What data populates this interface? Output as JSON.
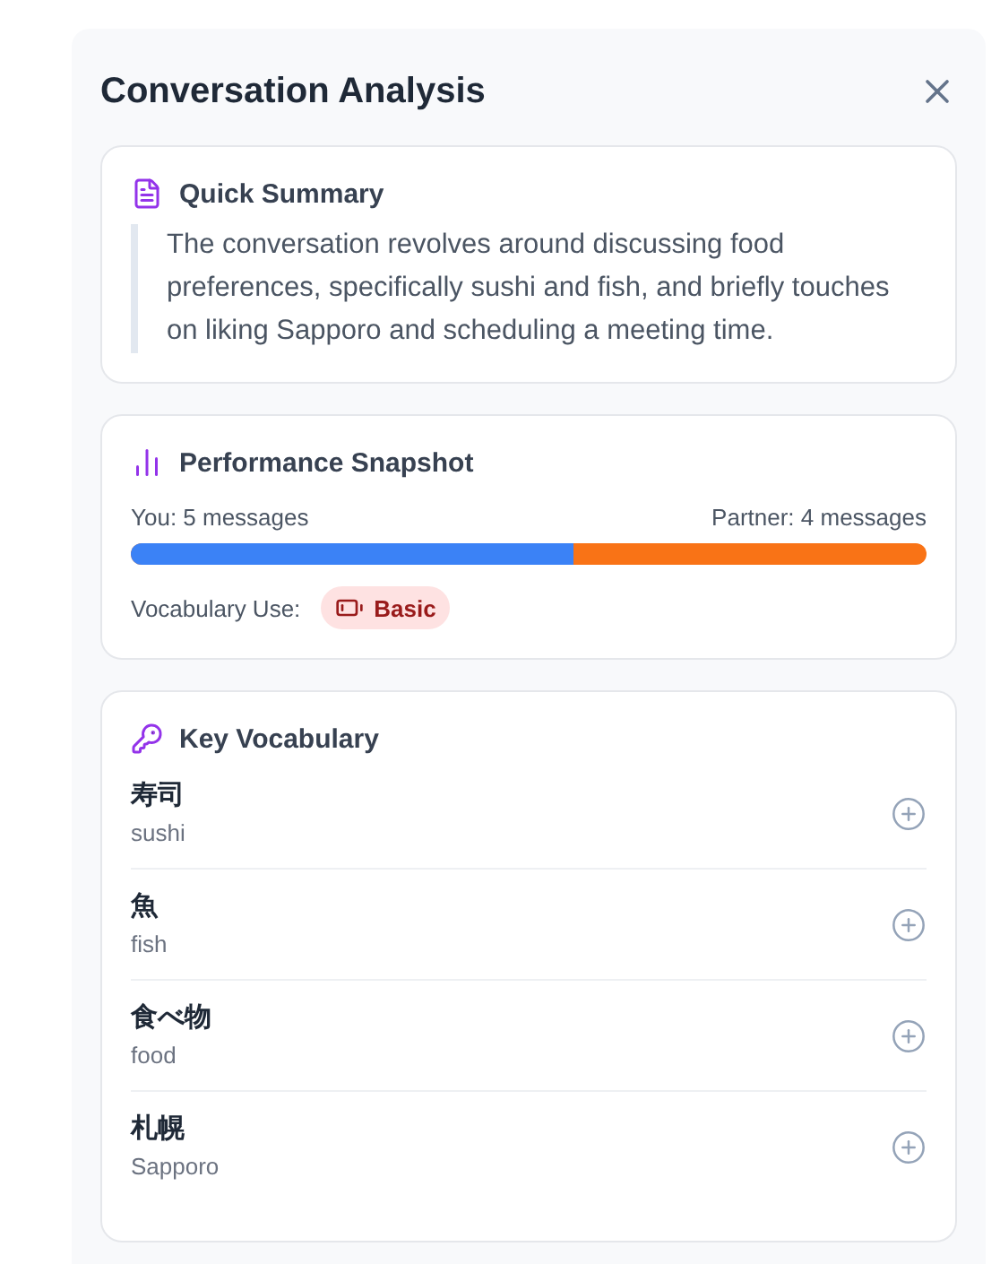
{
  "panel": {
    "title": "Conversation Analysis"
  },
  "summary": {
    "heading": "Quick Summary",
    "text": "The conversation revolves around discussing food preferences, specifically sushi and fish, and briefly touches on liking Sapporo and scheduling a meeting time."
  },
  "performance": {
    "heading": "Performance Snapshot",
    "you_label": "You: 5 messages",
    "partner_label": "Partner: 4 messages",
    "level": 0.556,
    "vocabulary_label": "Vocabulary Use:",
    "vocabulary_badge": "Basic"
  },
  "vocabulary": {
    "heading": "Key Vocabulary",
    "items": [
      {
        "word": "寿司",
        "meaning": "sushi"
      },
      {
        "word": "魚",
        "meaning": "fish"
      },
      {
        "word": "食べ物",
        "meaning": "food"
      },
      {
        "word": "札幌",
        "meaning": "Sapporo"
      }
    ]
  }
}
